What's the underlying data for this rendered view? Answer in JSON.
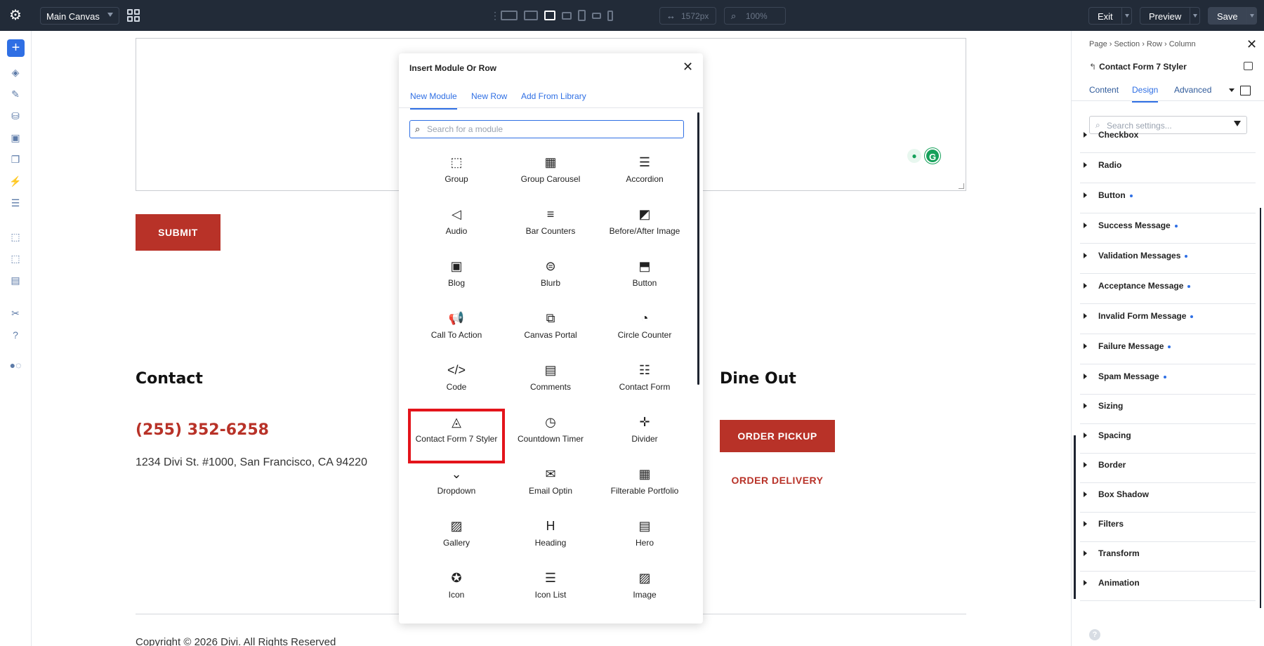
{
  "topbar": {
    "canvas_select": "Main Canvas",
    "width_value": "1572px",
    "zoom_value": "100%",
    "exit_label": "Exit",
    "preview_label": "Preview",
    "save_label": "Save"
  },
  "page": {
    "submit_label": "SUBMIT",
    "contact_heading": "Contact",
    "phone": "(255) 352-6258",
    "address": "1234 Divi St. #1000, San Francisco, CA 94220",
    "dineout_heading": "Dine Out",
    "order_pickup": "ORDER PICKUP",
    "order_delivery": "ORDER DELIVERY",
    "copyright": "Copyright © 2026 Divi. All Rights Reserved"
  },
  "modal": {
    "title": "Insert Module Or Row",
    "tabs": [
      "New Module",
      "New Row",
      "Add From Library"
    ],
    "search_placeholder": "Search for a module",
    "modules": [
      {
        "label": "Group",
        "icon": "group-icon",
        "glyph": "⬚"
      },
      {
        "label": "Group Carousel",
        "icon": "group-carousel-icon",
        "glyph": "▦"
      },
      {
        "label": "Accordion",
        "icon": "accordion-icon",
        "glyph": "☰"
      },
      {
        "label": "Audio",
        "icon": "audio-icon",
        "glyph": "◁"
      },
      {
        "label": "Bar Counters",
        "icon": "bar-counters-icon",
        "glyph": "≡"
      },
      {
        "label": "Before/After Image",
        "icon": "before-after-image-icon",
        "glyph": "◩"
      },
      {
        "label": "Blog",
        "icon": "blog-icon",
        "glyph": "▣"
      },
      {
        "label": "Blurb",
        "icon": "blurb-icon",
        "glyph": "⊜"
      },
      {
        "label": "Button",
        "icon": "button-icon",
        "glyph": "⬒"
      },
      {
        "label": "Call To Action",
        "icon": "call-to-action-icon",
        "glyph": "📢"
      },
      {
        "label": "Canvas Portal",
        "icon": "canvas-portal-icon",
        "glyph": "⧉"
      },
      {
        "label": "Circle Counter",
        "icon": "circle-counter-icon",
        "glyph": "◔"
      },
      {
        "label": "Code",
        "icon": "code-icon",
        "glyph": "</>"
      },
      {
        "label": "Comments",
        "icon": "comments-icon",
        "glyph": "▤"
      },
      {
        "label": "Contact Form",
        "icon": "contact-form-icon",
        "glyph": "☷"
      },
      {
        "label": "Contact Form 7 Styler",
        "icon": "contact-form-7-styler-icon",
        "glyph": "◬"
      },
      {
        "label": "Countdown Timer",
        "icon": "countdown-timer-icon",
        "glyph": "◷"
      },
      {
        "label": "Divider",
        "icon": "divider-icon",
        "glyph": "✛"
      },
      {
        "label": "Dropdown",
        "icon": "dropdown-icon",
        "glyph": "⌄"
      },
      {
        "label": "Email Optin",
        "icon": "email-optin-icon",
        "glyph": "✉"
      },
      {
        "label": "Filterable Portfolio",
        "icon": "filterable-portfolio-icon",
        "glyph": "▦"
      },
      {
        "label": "Gallery",
        "icon": "gallery-icon",
        "glyph": "▨"
      },
      {
        "label": "Heading",
        "icon": "heading-icon",
        "glyph": "H"
      },
      {
        "label": "Hero",
        "icon": "hero-icon",
        "glyph": "▤"
      },
      {
        "label": "Icon",
        "icon": "icon-module-icon",
        "glyph": "✪"
      },
      {
        "label": "Icon List",
        "icon": "icon-list-icon",
        "glyph": "☰"
      },
      {
        "label": "Image",
        "icon": "image-icon",
        "glyph": "▨"
      }
    ]
  },
  "rpanel": {
    "breadcrumb": "Page › Section › Row › Column",
    "title": "Contact Form 7 Styler",
    "tabs": [
      "Content",
      "Design",
      "Advanced"
    ],
    "search_placeholder": "Search settings...",
    "sections": [
      {
        "name": "Checkbox",
        "dot": false
      },
      {
        "name": "Radio",
        "dot": false
      },
      {
        "name": "Button",
        "dot": true
      },
      {
        "name": "Success Message",
        "dot": true
      },
      {
        "name": "Validation Messages",
        "dot": true
      },
      {
        "name": "Acceptance Message",
        "dot": true
      },
      {
        "name": "Invalid Form Message",
        "dot": true
      },
      {
        "name": "Failure Message",
        "dot": true
      },
      {
        "name": "Spam Message",
        "dot": true
      },
      {
        "name": "Sizing",
        "dot": false
      },
      {
        "name": "Spacing",
        "dot": false
      },
      {
        "name": "Border",
        "dot": false
      },
      {
        "name": "Box Shadow",
        "dot": false
      },
      {
        "name": "Filters",
        "dot": false
      },
      {
        "name": "Transform",
        "dot": false
      },
      {
        "name": "Animation",
        "dot": false
      }
    ]
  }
}
